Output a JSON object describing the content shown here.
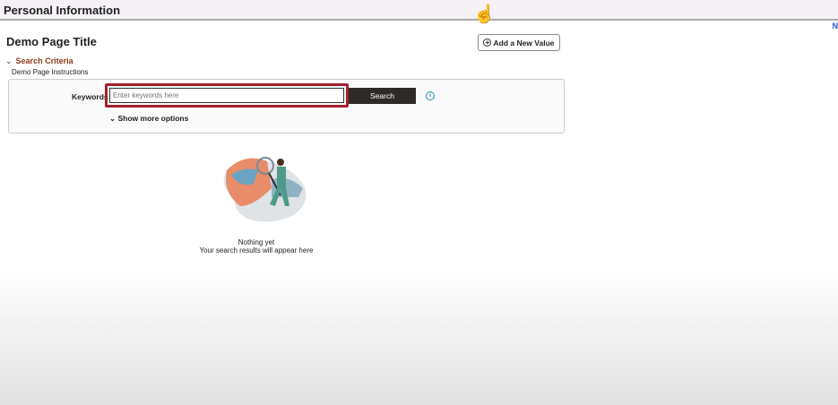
{
  "header": {
    "title": "Personal Information",
    "clipped_link": "N"
  },
  "page": {
    "title": "Demo Page Title",
    "add_button": "Add a New Value"
  },
  "search": {
    "section_label": "Search Criteria",
    "instructions": "Demo Page Instructions",
    "keywords_label": "Keywords",
    "placeholder": "Enter keywords here",
    "search_button": "Search",
    "more_options": "Show more options"
  },
  "empty": {
    "line1": "Nothing yet",
    "line2": "Your search results will appear here"
  },
  "colors": {
    "highlight": "#a3202d",
    "section": "#8a3b1a",
    "button": "#2d2a28"
  }
}
